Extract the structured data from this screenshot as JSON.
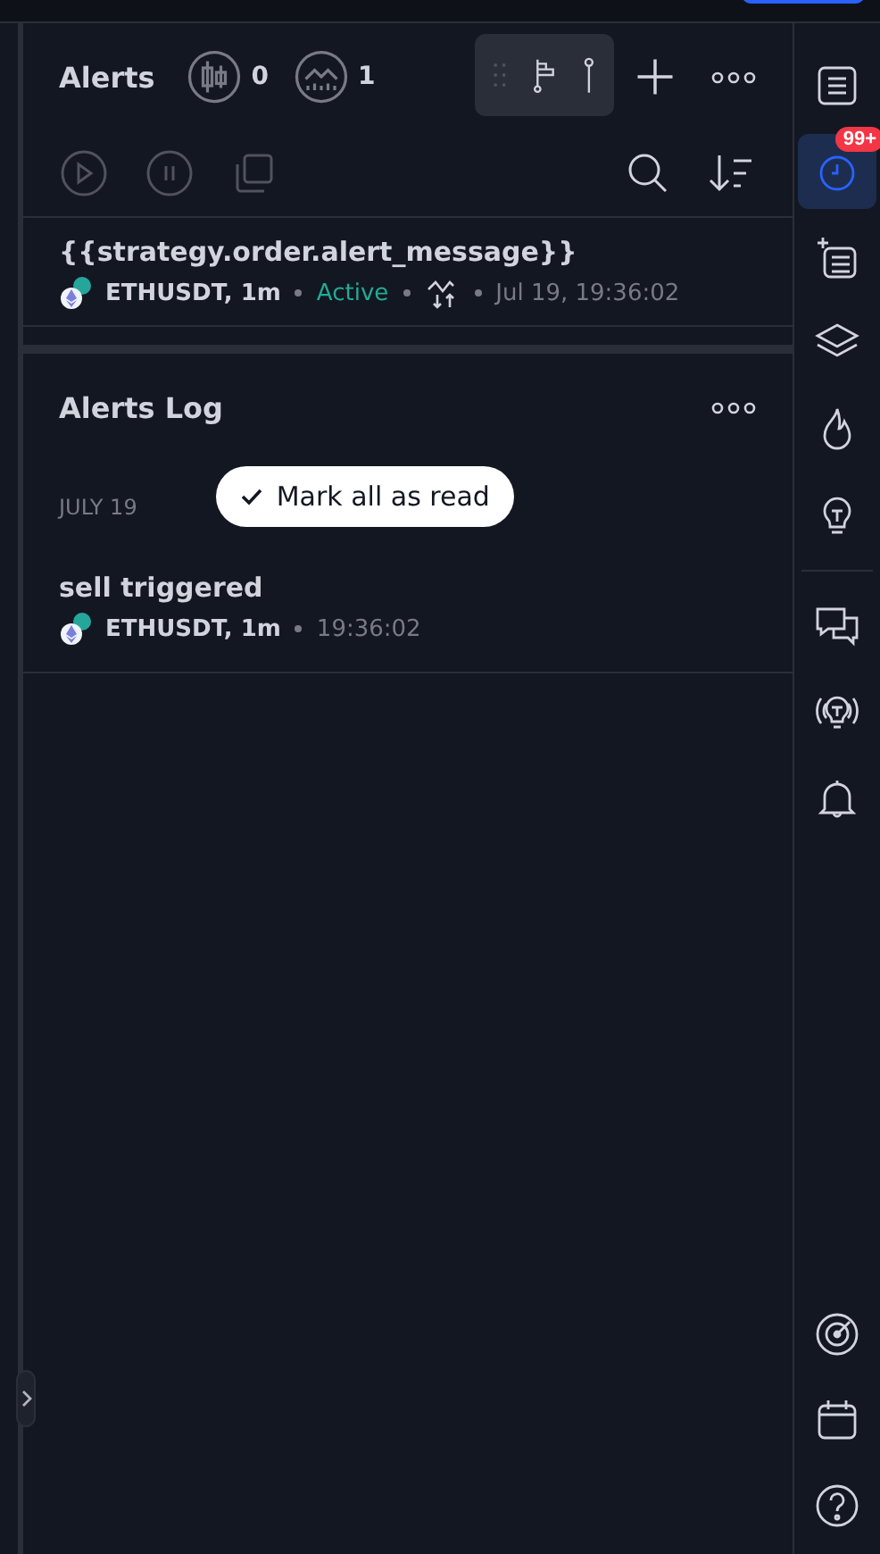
{
  "alerts": {
    "title": "Alerts",
    "counts": [
      {
        "kind": "price",
        "value": "0"
      },
      {
        "kind": "indicator",
        "value": "1"
      }
    ]
  },
  "alert_items": [
    {
      "message": "{{strategy.order.alert_message}}",
      "symbol": "ETHUSDT, 1m",
      "status": "Active",
      "time": "Jul 19, 19:36:02"
    }
  ],
  "log": {
    "title": "Alerts Log",
    "mark_button": "Mark all as read",
    "groups": [
      {
        "date": "JULY 19",
        "entries": [
          {
            "message": "sell triggered",
            "symbol": "ETHUSDT, 1m",
            "time": "19:36:02"
          }
        ]
      }
    ]
  },
  "sidebar": {
    "top": [
      {
        "kind": "watchlist",
        "selected": false
      },
      {
        "kind": "alerts",
        "selected": true,
        "badge": "99+"
      },
      {
        "kind": "add-list",
        "selected": false
      },
      {
        "kind": "layers",
        "selected": false
      },
      {
        "kind": "fire",
        "selected": false
      },
      {
        "kind": "bulb",
        "selected": false
      },
      {
        "kind": "chat",
        "selected": false
      },
      {
        "kind": "bulb-signal",
        "selected": false
      },
      {
        "kind": "bell",
        "selected": false
      }
    ],
    "bottom": [
      {
        "kind": "target",
        "selected": false
      },
      {
        "kind": "calendar",
        "selected": false
      },
      {
        "kind": "help",
        "selected": false
      }
    ]
  }
}
